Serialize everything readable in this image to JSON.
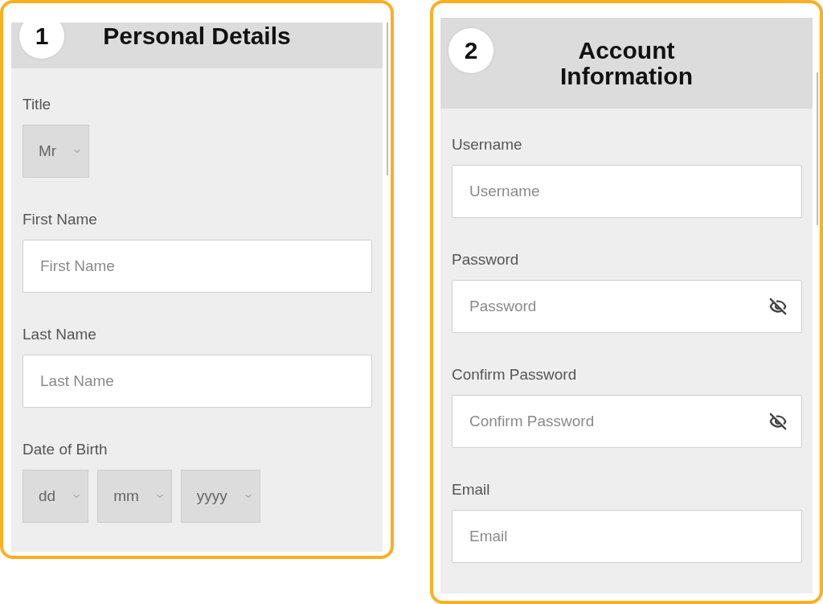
{
  "sections": [
    {
      "number": "1",
      "title": "Personal Details",
      "fields": [
        {
          "kind": "select_group",
          "label": "Title",
          "selects": [
            {
              "value": "Mr"
            }
          ]
        },
        {
          "kind": "text",
          "label": "First Name",
          "placeholder": "First Name"
        },
        {
          "kind": "text",
          "label": "Last Name",
          "placeholder": "Last Name"
        },
        {
          "kind": "select_group",
          "label": "Date of Birth",
          "selects": [
            {
              "value": "dd"
            },
            {
              "value": "mm"
            },
            {
              "value": "yyyy"
            }
          ]
        }
      ]
    },
    {
      "number": "2",
      "title": "Account Information",
      "fields": [
        {
          "kind": "text",
          "label": "Username",
          "placeholder": "Username"
        },
        {
          "kind": "password",
          "label": "Password",
          "placeholder": "Password"
        },
        {
          "kind": "password",
          "label": "Confirm Password",
          "placeholder": "Confirm Password"
        },
        {
          "kind": "text",
          "label": "Email",
          "placeholder": "Email"
        }
      ]
    }
  ]
}
